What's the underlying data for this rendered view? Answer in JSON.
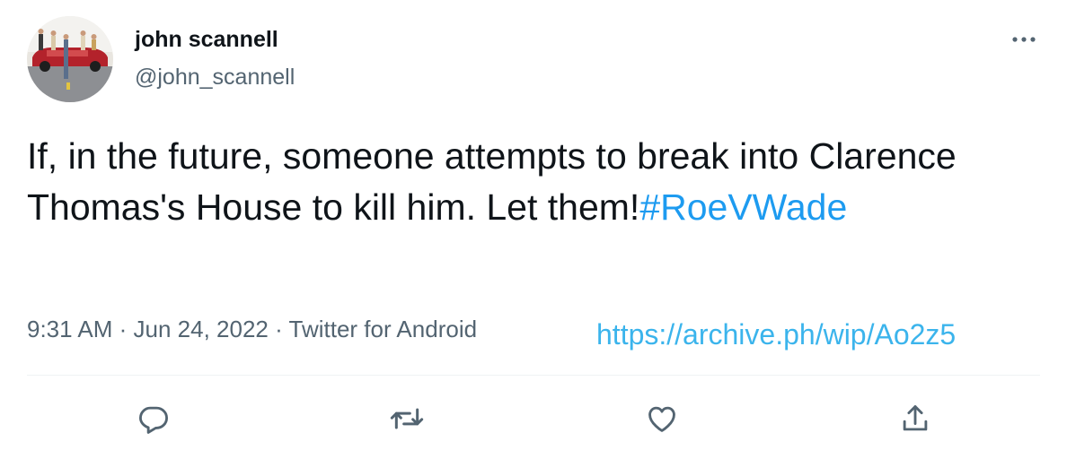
{
  "author": {
    "display_name": "john scannell",
    "handle": "@john_scannell"
  },
  "tweet": {
    "text_before_hashtag": "If, in the future, someone attempts to break into Clarence Thomas's House to kill him. Let them!",
    "hashtag": "#RoeVWade"
  },
  "meta": {
    "time": "9:31 AM",
    "separator1": " · ",
    "date": "Jun 24, 2022",
    "separator2": " · ",
    "source": "Twitter for Android"
  },
  "archive_link": "https://archive.ph/wip/Ao2z5",
  "actions": {
    "reply_icon": "reply-icon",
    "retweet_icon": "retweet-icon",
    "like_icon": "like-icon",
    "share_icon": "share-icon",
    "more_icon": "more-icon"
  },
  "colors": {
    "text": "#0f1419",
    "secondary": "#536471",
    "link": "#1d9bf0",
    "archive_link": "#3bb4ec"
  }
}
